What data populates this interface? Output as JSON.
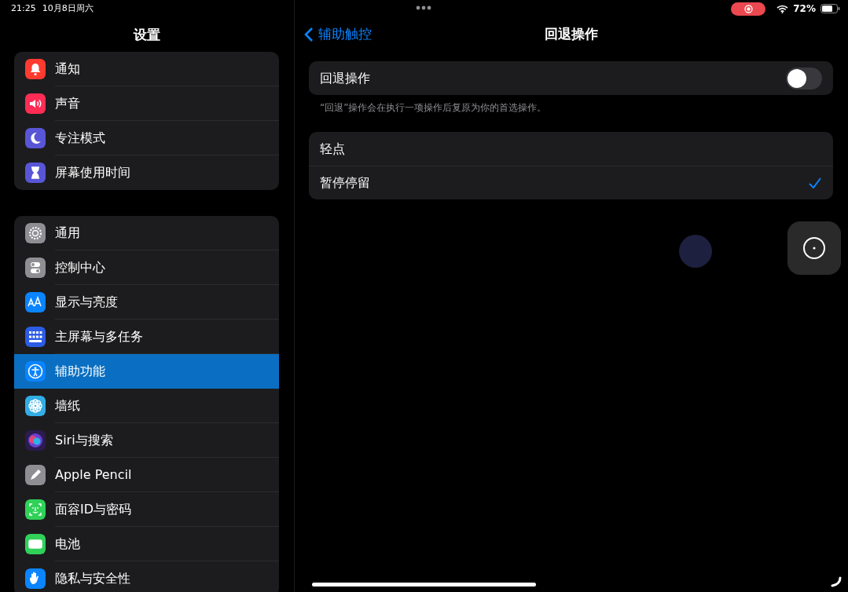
{
  "status_bar": {
    "time": "21:25",
    "date": "10月8日周六",
    "recording": true,
    "battery_text": "72%"
  },
  "sidebar": {
    "title": "设置",
    "groups": [
      {
        "items": [
          {
            "label": "通知",
            "kind": "bell",
            "color": "#ff3b30",
            "selected": false
          },
          {
            "label": "声音",
            "kind": "speaker",
            "color": "#ff2d55",
            "selected": false
          },
          {
            "label": "专注模式",
            "kind": "moon",
            "color": "#5856d6",
            "selected": false
          },
          {
            "label": "屏幕使用时间",
            "kind": "hourglass",
            "color": "#5856d6",
            "selected": false
          }
        ]
      },
      {
        "items": [
          {
            "label": "通用",
            "kind": "gear",
            "color": "#8e8e93",
            "selected": false
          },
          {
            "label": "控制中心",
            "kind": "switches",
            "color": "#8e8e93",
            "selected": false
          },
          {
            "label": "显示与亮度",
            "kind": "text-size",
            "color": "#0a84ff",
            "selected": false
          },
          {
            "label": "主屏幕与多任务",
            "kind": "grid",
            "color": "#2c5ce6",
            "selected": false
          },
          {
            "label": "辅助功能",
            "kind": "person-circle",
            "color": "#0a84ff",
            "selected": true
          },
          {
            "label": "墙纸",
            "kind": "flower",
            "color": "#32ade6",
            "selected": false
          },
          {
            "label": "Siri与搜索",
            "kind": "orb",
            "color": "#2b1b4f",
            "selected": false
          },
          {
            "label": "Apple Pencil",
            "kind": "pencil",
            "color": "#8e8e93",
            "selected": false
          },
          {
            "label": "面容ID与密码",
            "kind": "face",
            "color": "#30d158",
            "selected": false
          },
          {
            "label": "电池",
            "kind": "battery",
            "color": "#30d158",
            "selected": false
          },
          {
            "label": "隐私与安全性",
            "kind": "hand",
            "color": "#0a84ff",
            "selected": false
          }
        ]
      }
    ]
  },
  "detail": {
    "back_label": "辅助触控",
    "title": "回退操作",
    "toggle": {
      "label": "回退操作",
      "on": false
    },
    "footnote": "“回退”操作会在执行一项操作后复原为你的首选操作。",
    "options": [
      {
        "label": "轻点",
        "selected": false
      },
      {
        "label": "暂停停留",
        "selected": true
      }
    ]
  }
}
